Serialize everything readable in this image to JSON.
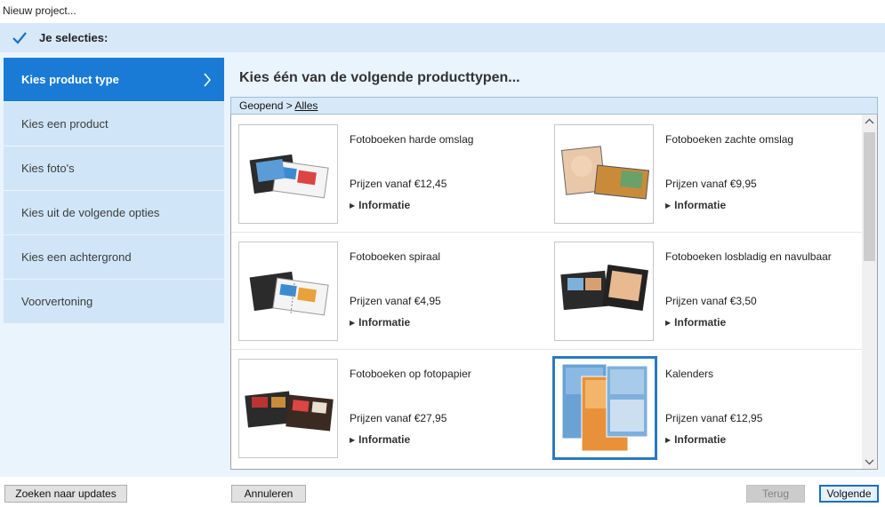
{
  "window": {
    "title": "Nieuw project..."
  },
  "selections": {
    "label": "Je selecties:"
  },
  "sidebar": {
    "items": [
      {
        "label": "Kies product type",
        "active": true
      },
      {
        "label": "Kies een product"
      },
      {
        "label": "Kies foto's"
      },
      {
        "label": "Kies uit de volgende opties"
      },
      {
        "label": "Kies een achtergrond"
      },
      {
        "label": "Voorvertoning"
      }
    ]
  },
  "main": {
    "heading": "Kies één van de volgende producttypen...",
    "breadcrumb": {
      "prefix": "Geopend >",
      "link": "Alles"
    },
    "products": [
      {
        "name": "Fotoboeken harde omslag",
        "price": "Prijzen vanaf €12,45",
        "info": "Informatie"
      },
      {
        "name": "Fotoboeken zachte omslag",
        "price": "Prijzen vanaf €9,95",
        "info": "Informatie"
      },
      {
        "name": "Fotoboeken spiraal",
        "price": "Prijzen vanaf €4,95",
        "info": "Informatie"
      },
      {
        "name": "Fotoboeken losbladig en navulbaar",
        "price": "Prijzen vanaf €3,50",
        "info": "Informatie"
      },
      {
        "name": "Fotoboeken op fotopapier",
        "price": "Prijzen vanaf €27,95",
        "info": "Informatie"
      },
      {
        "name": "Kalenders",
        "price": "Prijzen vanaf €12,95",
        "info": "Informatie",
        "selected": true
      }
    ]
  },
  "footer": {
    "updates": "Zoeken naar updates",
    "cancel": "Annuleren",
    "back": "Terug",
    "next": "Volgende"
  },
  "colors": {
    "accent": "#1a7bd6",
    "sidebar": "#d0e6f8",
    "panel": "#eaf4fd"
  }
}
